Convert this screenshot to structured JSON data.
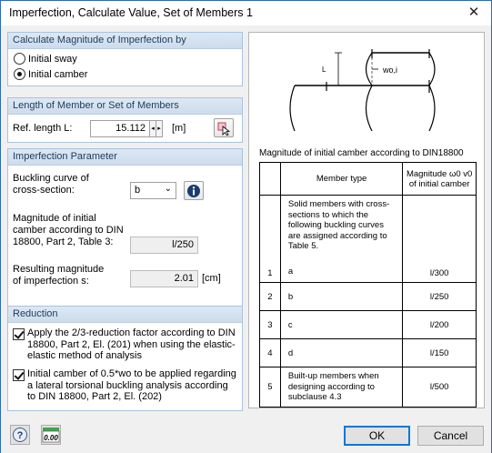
{
  "window": {
    "title": "Imperfection, Calculate Value, Set of Members  1"
  },
  "calc_group": {
    "header": "Calculate Magnitude of Imperfection by",
    "options": [
      {
        "label": "Initial sway",
        "selected": false
      },
      {
        "label": "Initial camber",
        "selected": true
      }
    ]
  },
  "length_group": {
    "header": "Length of Member or Set of Members",
    "ref_label": "Ref. length L:",
    "ref_value": "15.112",
    "unit": "[m]"
  },
  "param_group": {
    "header": "Imperfection Parameter",
    "buckling_label_1": "Buckling curve of",
    "buckling_label_2": "cross-section:",
    "buckling_value": "b",
    "initial_label_1": "Magnitude of initial",
    "initial_label_2": "camber according to DIN",
    "initial_label_3": "18800, Part 2, Table 3:",
    "initial_value": "l/250",
    "result_label_1": "Resulting magnitude",
    "result_label_2": "of imperfection s:",
    "result_value": "2.01",
    "result_unit": "[cm]"
  },
  "reduction_group": {
    "header": "Reduction",
    "check1": {
      "checked": true,
      "text": "Apply the 2/3-reduction factor according to DIN 18800, Part 2, El. (201) when using the elastic-elastic method of analysis"
    },
    "check2": {
      "checked": true,
      "text": "Initial camber of 0.5*wo to be applied regarding a lateral torsional buckling analysis according to DIN 18800, Part 2, El. (202)"
    }
  },
  "figure": {
    "label_l": "L",
    "label_w": "wo,i"
  },
  "table": {
    "caption": "Magnitude of initial camber according to DIN18800",
    "col_member": "Member type",
    "col_mag_1": "Magnitude ω0 v0",
    "col_mag_2": "of initial camber",
    "rows": [
      {
        "num": "1",
        "type": "Solid members with cross-sections to which the following buckling curves are assigned according to Table 5.",
        "sub": "a",
        "value": "l/300"
      },
      {
        "num": "2",
        "type": "",
        "sub": "b",
        "value": "l/250"
      },
      {
        "num": "3",
        "type": "",
        "sub": "c",
        "value": "l/200"
      },
      {
        "num": "4",
        "type": "",
        "sub": "d",
        "value": "l/150"
      },
      {
        "num": "5",
        "type": "Built-up members when designing according to subclause 4.3",
        "sub": "",
        "value": "l/500"
      }
    ]
  },
  "buttons": {
    "ok": "OK",
    "cancel": "Cancel",
    "units": "0.00"
  }
}
